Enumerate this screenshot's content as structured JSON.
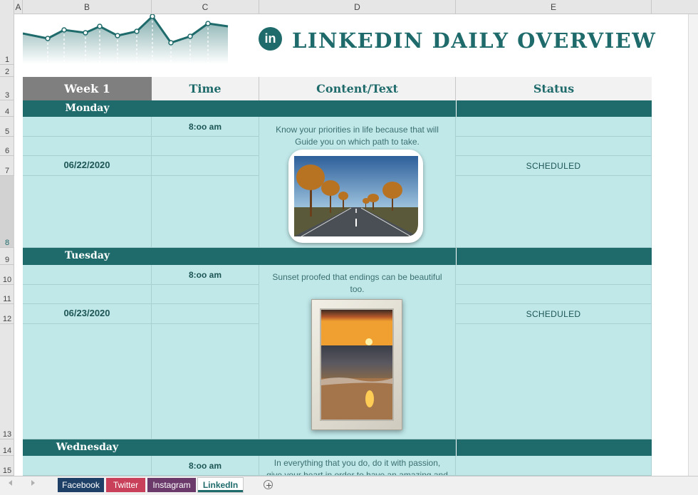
{
  "columns": [
    "A",
    "B",
    "C",
    "D",
    "E"
  ],
  "rows": [
    "1",
    "2",
    "3",
    "4",
    "5",
    "6",
    "7",
    "8",
    "9",
    "10",
    "11",
    "12",
    "13",
    "14",
    "15"
  ],
  "title": "LINKEDIN DAILY OVERVIEW",
  "logo_text": "in",
  "headers": {
    "week": "Week 1",
    "time": "Time",
    "content": "Content/Text",
    "status": "Status"
  },
  "days": [
    {
      "name": "Monday",
      "time": "8:oo am",
      "date": "06/22/2020",
      "status": "SCHEDULED",
      "content": "Know your priorities in life because that will Guide you on which path to take.",
      "image": "tree-lined-road-photo"
    },
    {
      "name": "Tuesday",
      "time": "8:oo am",
      "date": "06/23/2020",
      "status": "SCHEDULED",
      "content": "Sunset proofed that endings can be beautiful too.",
      "image": "sunset-over-sea-photo"
    },
    {
      "name": "Wednesday",
      "time": "8:oo am",
      "content": "In everything that you do, do it with passion, give your heart in order to have an amazing and"
    }
  ],
  "tabs": [
    {
      "label": "Facebook",
      "color": "#1e3f66",
      "active": false
    },
    {
      "label": "Twitter",
      "color": "#c8405a",
      "active": false
    },
    {
      "label": "Instagram",
      "color": "#6b3a6b",
      "active": false
    },
    {
      "label": "LinkedIn",
      "color": "#1f6b6b",
      "active": true
    }
  ],
  "icons": {
    "add_sheet": "plus-circle-icon",
    "nav_prev": "triangle-left-icon",
    "nav_next": "triangle-right-icon"
  },
  "colors": {
    "accent": "#1f6b6b",
    "cell_fill": "#c0e8e9",
    "header_gray": "#7f7f7f"
  }
}
